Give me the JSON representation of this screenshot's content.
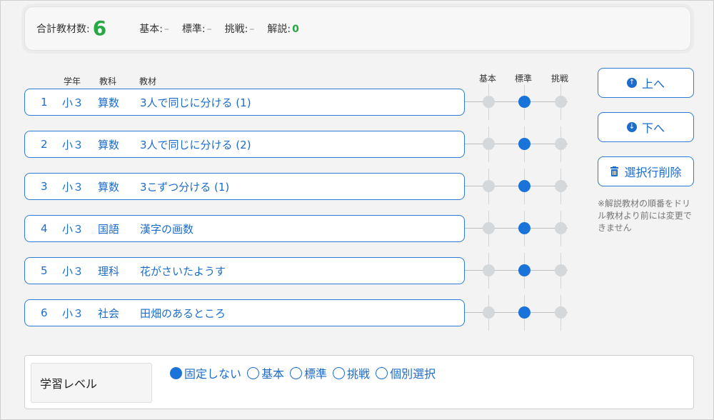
{
  "summary": {
    "total_label": "合計教材数:",
    "total_value": "6",
    "stats": [
      {
        "label": "基本:",
        "value": "–"
      },
      {
        "label": "標準:",
        "value": "–"
      },
      {
        "label": "挑戦:",
        "value": "–"
      },
      {
        "label": "解説:",
        "value": "0"
      }
    ]
  },
  "columns": {
    "grade": "学年",
    "subject": "教科",
    "material": "教材"
  },
  "levels": {
    "basic": "基本",
    "standard": "標準",
    "challenge": "挑戦"
  },
  "rows": [
    {
      "num": "1",
      "grade": "小３",
      "subject": "算数",
      "material": "3人で同じに分ける (1)",
      "level": "standard"
    },
    {
      "num": "2",
      "grade": "小３",
      "subject": "算数",
      "material": "3人で同じに分ける (2)",
      "level": "standard"
    },
    {
      "num": "3",
      "grade": "小３",
      "subject": "算数",
      "material": "3こずつ分ける (1)",
      "level": "standard"
    },
    {
      "num": "4",
      "grade": "小３",
      "subject": "国語",
      "material": "漢字の画数",
      "level": "standard"
    },
    {
      "num": "5",
      "grade": "小３",
      "subject": "理科",
      "material": "花がさいたようす",
      "level": "standard"
    },
    {
      "num": "6",
      "grade": "小３",
      "subject": "社会",
      "material": "田畑のあるところ",
      "level": "standard"
    }
  ],
  "buttons": {
    "up": "上へ",
    "down": "下へ",
    "delete": "選択行削除"
  },
  "note": "※解説教材の順番をドリル教材より前には変更できません",
  "learning_level": {
    "label": "学習レベル",
    "options": [
      "固定しない",
      "基本",
      "標準",
      "挑戦",
      "個別選択"
    ],
    "selected": "固定しない"
  },
  "colors": {
    "accent": "#1a73d9",
    "green": "#28a745"
  }
}
